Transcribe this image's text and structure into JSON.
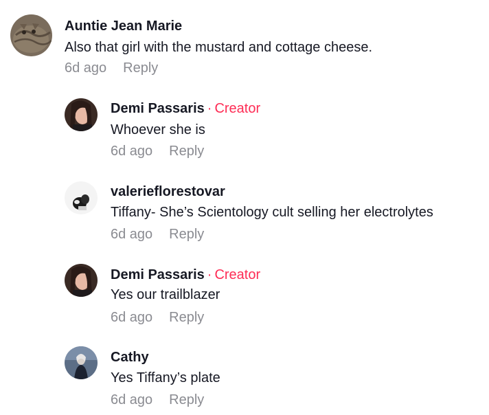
{
  "comments": [
    {
      "author": "Auntie Jean Marie",
      "text": "Also that girl with the mustard and cottage cheese.",
      "time": "6d ago",
      "reply_label": "Reply",
      "is_creator": false
    },
    {
      "author": "Demi Passaris",
      "creator_label": "Creator",
      "text": "Whoever she is",
      "time": "6d ago",
      "reply_label": "Reply",
      "is_creator": true
    },
    {
      "author": "valerieflorestovar",
      "text": "Tiffany- She’s Scientology cult selling her electrolytes",
      "time": "6d ago",
      "reply_label": "Reply",
      "is_creator": false
    },
    {
      "author": "Demi Passaris",
      "creator_label": "Creator",
      "text": "Yes our trailblazer",
      "time": "6d ago",
      "reply_label": "Reply",
      "is_creator": true
    },
    {
      "author": "Cathy",
      "text": "Yes Tiffany’s plate",
      "time": "6d ago",
      "reply_label": "Reply",
      "is_creator": false
    }
  ],
  "colors": {
    "text": "#161823",
    "muted": "#8a8b91",
    "creator_accent": "#fe2c55"
  },
  "creator_separator": "·",
  "icons": [
    "cat-avatar",
    "creator-avatar",
    "user-avatar",
    "creator-avatar",
    "user-avatar"
  ]
}
